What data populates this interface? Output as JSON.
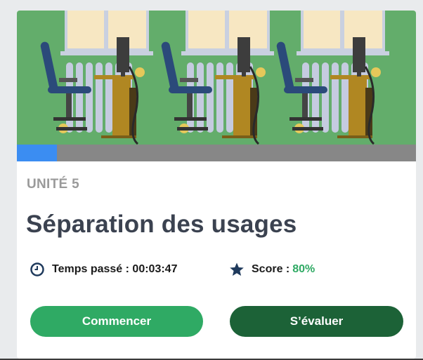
{
  "course": {
    "unit_label": "UNITÉ 5",
    "title": "Séparation des usages",
    "progress_fraction": 0.1,
    "time_label": "Temps passé : 00:03:47",
    "score_label": "Score :",
    "score_value": "80%",
    "icons": {
      "time": "clock-icon",
      "score": "star-icon"
    },
    "buttons": {
      "start_label": "Commencer",
      "evaluate_label": "S’évaluer"
    },
    "colors": {
      "banner_bg": "#63ad6b",
      "progress_fill": "#3b8df2",
      "progress_track": "#878787",
      "start_button": "#2faa64",
      "evaluate_button": "#1c6237",
      "score_value": "#2faa64"
    }
  }
}
